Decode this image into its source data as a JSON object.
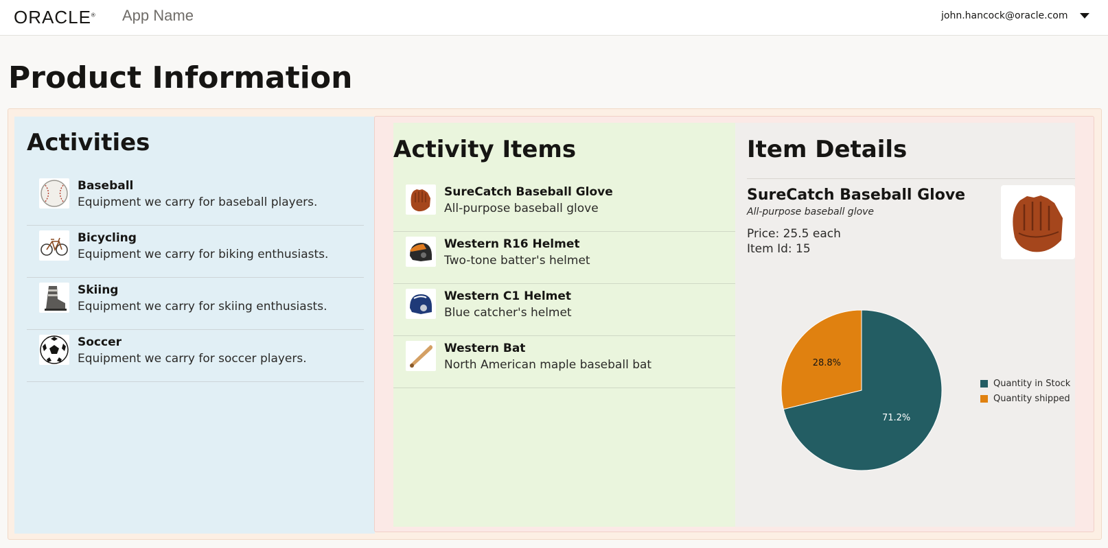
{
  "header": {
    "logo_text": "ORACLE",
    "app_name": "App Name",
    "user_email": "john.hancock@oracle.com"
  },
  "page": {
    "title": "Product Information"
  },
  "activities": {
    "title": "Activities",
    "items": [
      {
        "name": "Baseball",
        "description": "Equipment we carry for baseball players.",
        "icon": "baseball-icon"
      },
      {
        "name": "Bicycling",
        "description": "Equipment we carry for biking enthusiasts.",
        "icon": "bicycle-icon"
      },
      {
        "name": "Skiing",
        "description": "Equipment we carry for skiing enthusiasts.",
        "icon": "ski-boot-icon"
      },
      {
        "name": "Soccer",
        "description": "Equipment we carry for soccer players.",
        "icon": "soccer-ball-icon"
      }
    ]
  },
  "activity_items": {
    "title": "Activity Items",
    "items": [
      {
        "name": "SureCatch Baseball Glove",
        "description": "All-purpose baseball glove",
        "icon": "baseball-glove-icon"
      },
      {
        "name": "Western R16 Helmet",
        "description": "Two-tone batter's helmet",
        "icon": "batting-helmet-icon"
      },
      {
        "name": "Western C1 Helmet",
        "description": "Blue catcher's helmet",
        "icon": "catcher-helmet-icon"
      },
      {
        "name": "Western Bat",
        "description": "North American maple baseball bat",
        "icon": "baseball-bat-icon"
      }
    ]
  },
  "item_details": {
    "title": "Item Details",
    "name": "SureCatch Baseball Glove",
    "short_desc": "All-purpose baseball glove",
    "price_text": "Price: 25.5 each",
    "id_text": "Item Id: 15",
    "image_icon": "baseball-glove-icon"
  },
  "chart_data": {
    "type": "pie",
    "title": "",
    "series": [
      {
        "name": "Quantity in Stock",
        "value": 71.2,
        "label": "71.2%",
        "color": "#235d63"
      },
      {
        "name": "Quantity shipped",
        "value": 28.8,
        "label": "28.8%",
        "color": "#e08110"
      }
    ],
    "legend_position": "right"
  },
  "colors": {
    "stock": "#235d63",
    "shipped": "#e08110",
    "activities_bg": "#e1eff5",
    "items_bg": "#eaf5dd",
    "details_bg": "#f0eeec"
  }
}
